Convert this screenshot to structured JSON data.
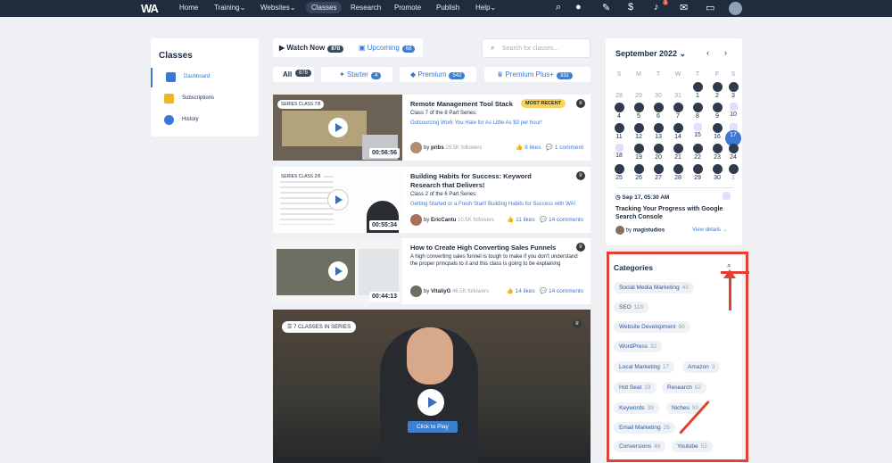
{
  "nav": {
    "logo": "WA",
    "items": [
      "Home",
      "Training",
      "Websites",
      "Classes",
      "Research",
      "Promote",
      "Publish",
      "Help"
    ],
    "notif_count": "1",
    "icons": [
      "search-icon",
      "chat-icon",
      "pen-icon",
      "dollar-icon",
      "bell-icon",
      "mail-icon",
      "inbox-icon"
    ]
  },
  "sidebar": {
    "title": "Classes",
    "items": [
      {
        "label": "Dashboard",
        "color": "#3a78d4"
      },
      {
        "label": "Subscriptions",
        "color": "#f0b429"
      },
      {
        "label": "History",
        "color": "#3a78d4"
      }
    ]
  },
  "top_tabs": {
    "watch_now": "Watch Now",
    "watch_now_count": "878",
    "upcoming": "Upcoming",
    "upcoming_count": "68"
  },
  "search": {
    "placeholder": "Search for classes..."
  },
  "filters": [
    {
      "label": "All",
      "count": "878"
    },
    {
      "label": "Starter",
      "count": "4"
    },
    {
      "label": "Premium",
      "count": "542"
    },
    {
      "label": "Premium Plus+",
      "count": "332"
    }
  ],
  "classes": [
    {
      "series": "SERIES CLASS 7/8",
      "duration": "00:56:56",
      "title": "Remote Management Tool Stack",
      "badge": "MOST RECENT",
      "sub": "Class 7 of the 8 Part Series:",
      "link": "Outsourcing Work You Hate for As Little As $3 per hour!",
      "author": "pribs",
      "followers": "29.5K followers",
      "likes": "8 likes",
      "comments": "1 comment"
    },
    {
      "series": "SERIES CLASS 2/6",
      "duration": "00:55:34",
      "title": "Building Habits for Success: Keyword Research that Delivers!",
      "sub": "Class 2 of the 6 Part Series:",
      "link": "Getting Started or a Fresh Start! Building Habits for Success with WA!",
      "author": "EricCantu",
      "followers": "10.5K followers",
      "likes": "11 likes",
      "comments": "14 comments"
    },
    {
      "duration": "00:44:13",
      "title": "How to Create High Converting Sales Funnels",
      "desc": "A high converting sales funnel is tough to make if you don't understand the proper princpals to it and this class is going to be explaining",
      "author": "VitaliyG",
      "followers": "46.5K followers",
      "likes": "14 likes",
      "comments": "14 comments"
    }
  ],
  "featured": {
    "series": "7 CLASSES IN SERIES",
    "button": "Click to Play"
  },
  "calendar": {
    "month": "September 2022",
    "dow": [
      "S",
      "M",
      "T",
      "W",
      "T",
      "F",
      "S"
    ],
    "weeks": [
      [
        "28",
        "29",
        "30",
        "31",
        "1",
        "2",
        "3"
      ],
      [
        "4",
        "5",
        "6",
        "7",
        "8",
        "9",
        "10"
      ],
      [
        "11",
        "12",
        "13",
        "14",
        "15",
        "16",
        "17"
      ],
      [
        "18",
        "19",
        "20",
        "21",
        "22",
        "23",
        "24"
      ],
      [
        "25",
        "26",
        "27",
        "28",
        "29",
        "30",
        "1"
      ]
    ],
    "today": "17",
    "event": {
      "date": "Sep 17, 05:30 AM",
      "title": "Tracking Your Progress with Google Search Console",
      "by_prefix": "by",
      "by": "magistudios",
      "view": "View details →"
    }
  },
  "categories": {
    "title": "Categories",
    "items": [
      {
        "name": "Social Media Marketing",
        "count": "43"
      },
      {
        "name": "SEO",
        "count": "118"
      },
      {
        "name": "Website Development",
        "count": "60"
      },
      {
        "name": "WordPress",
        "count": "32"
      },
      {
        "name": "Local Marketing",
        "count": "17"
      },
      {
        "name": "Amazon",
        "count": "3"
      },
      {
        "name": "Hot Seat",
        "count": "19"
      },
      {
        "name": "Research",
        "count": "62"
      },
      {
        "name": "Keywords",
        "count": "39"
      },
      {
        "name": "Niches",
        "count": "90"
      },
      {
        "name": "Email Marketing",
        "count": "26"
      },
      {
        "name": "Conversions",
        "count": "48"
      },
      {
        "name": "Youtube",
        "count": "52"
      }
    ]
  },
  "colors": {
    "nav": "#1f2c3e",
    "accent": "#3a78d4",
    "annotation": "#e2412f"
  }
}
